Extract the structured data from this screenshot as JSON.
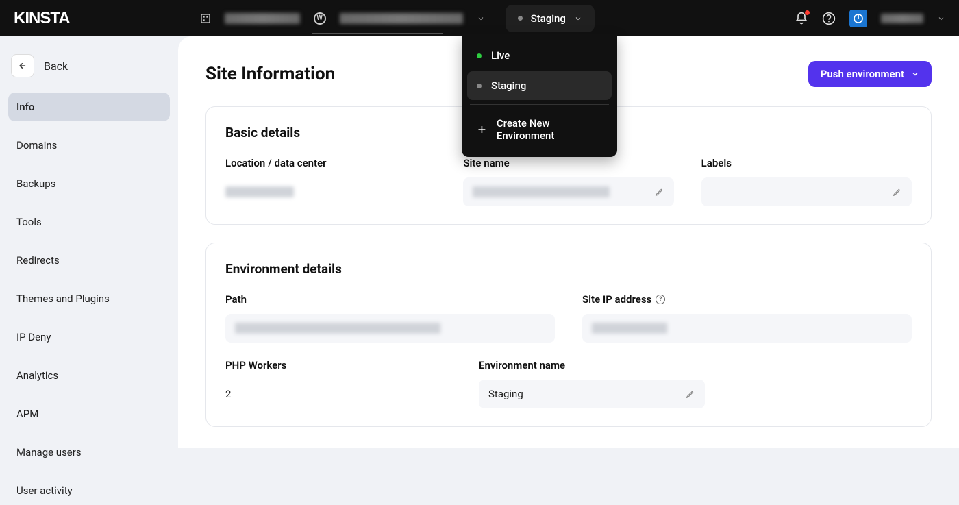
{
  "brand": "KINSTA",
  "topbar": {
    "env_selected": "Staging"
  },
  "dropdown": {
    "items": [
      {
        "label": "Live",
        "status": "live",
        "selected": false
      },
      {
        "label": "Staging",
        "status": "staging",
        "selected": true
      }
    ],
    "create_label": "Create New Environment"
  },
  "sidebar": {
    "back_label": "Back",
    "items": [
      {
        "label": "Info",
        "active": true
      },
      {
        "label": "Domains",
        "active": false
      },
      {
        "label": "Backups",
        "active": false
      },
      {
        "label": "Tools",
        "active": false
      },
      {
        "label": "Redirects",
        "active": false
      },
      {
        "label": "Themes and Plugins",
        "active": false
      },
      {
        "label": "IP Deny",
        "active": false
      },
      {
        "label": "Analytics",
        "active": false
      },
      {
        "label": "APM",
        "active": false
      },
      {
        "label": "Manage users",
        "active": false
      },
      {
        "label": "User activity",
        "active": false
      }
    ]
  },
  "page": {
    "title": "Site Information",
    "push_button": "Push environment"
  },
  "basic": {
    "heading": "Basic details",
    "location_label": "Location / data center",
    "sitename_label": "Site name",
    "labels_label": "Labels"
  },
  "env": {
    "heading": "Environment details",
    "path_label": "Path",
    "ip_label": "Site IP address",
    "workers_label": "PHP Workers",
    "workers_value": "2",
    "envname_label": "Environment name",
    "envname_value": "Staging"
  }
}
